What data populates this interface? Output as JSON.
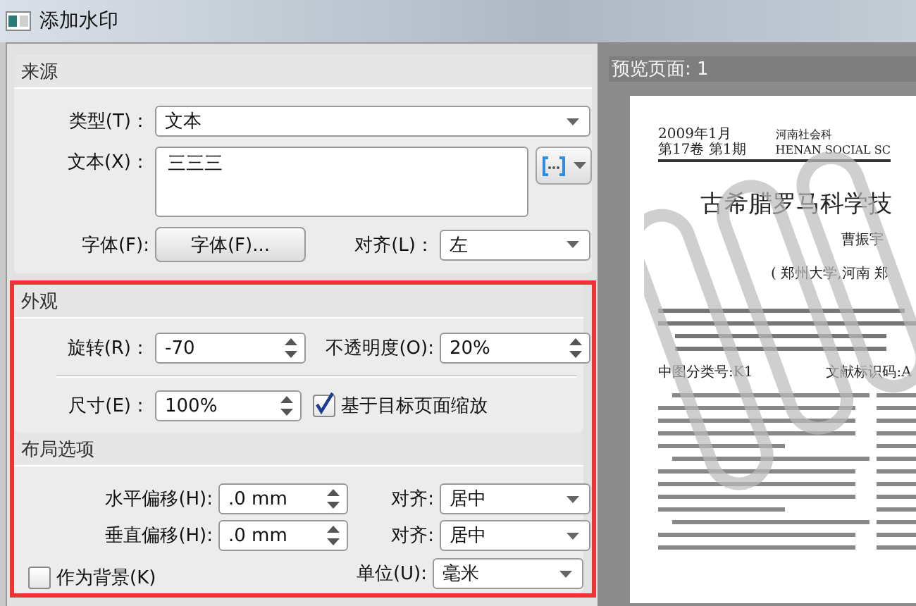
{
  "window": {
    "title": "添加水印"
  },
  "source": {
    "title": "来源",
    "type": {
      "label": "类型(T)：",
      "value": "文本"
    },
    "text": {
      "label": "文本(X)：",
      "value": "三三三"
    },
    "font": {
      "label": "字体(F):",
      "button": "字体(F)..."
    },
    "align": {
      "label": "对齐(L)：",
      "value": "左"
    }
  },
  "appearance": {
    "title": "外观",
    "rotation": {
      "label": "旋转(R)：",
      "value": "-70"
    },
    "opacity": {
      "label": "不透明度(O):",
      "value": "20%"
    },
    "size": {
      "label": "尺寸(E)：",
      "value": "100%"
    },
    "scale_to_page": {
      "label": "基于目标页面缩放",
      "checked": true
    }
  },
  "layout": {
    "title": "布局选项",
    "rows": [
      {
        "label": "水平偏移(H):",
        "value": ".0 mm",
        "align_label": "对齐:",
        "align_value": "居中"
      },
      {
        "label": "垂直偏移(H):",
        "value": ".0 mm",
        "align_label": "对齐:",
        "align_value": "居中"
      }
    ],
    "background": {
      "label": "作为背景(K)",
      "checked": false
    },
    "unit": {
      "label": "单位(U):",
      "value": "毫米"
    }
  },
  "preview": {
    "title": "预览页面: 1",
    "page": {
      "header_left": [
        "2009年1月",
        "第17卷 第1期"
      ],
      "header_right": [
        "河南社会科",
        "HENAN SOCIAL SC"
      ],
      "title": "古希腊罗马科学技",
      "author": "曹振宇",
      "affiliation": "( 郑州大学,河南  郑",
      "classification": "中图分类号:K1",
      "doc_code": "文献标识码:A"
    }
  }
}
